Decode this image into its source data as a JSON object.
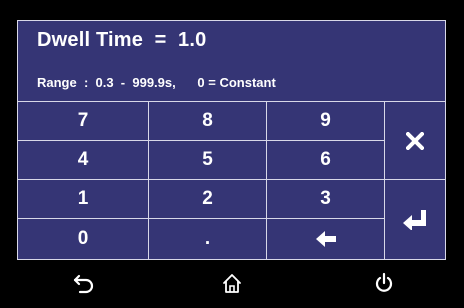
{
  "header": {
    "title": "Dwell Time  =  1.0",
    "range": "Range  :  0.3  -  999.9s,      0 = Constant"
  },
  "keypad": {
    "keys": [
      "7",
      "8",
      "9",
      "4",
      "5",
      "6",
      "1",
      "2",
      "3",
      "0",
      "."
    ],
    "clear_icon": "close-x-icon",
    "enter_icon": "enter-arrow-icon",
    "backspace_icon": "left-arrow-icon"
  },
  "footer": {
    "back_icon": "return-arrow-icon",
    "home_icon": "home-icon",
    "power_icon": "power-icon"
  },
  "colors": {
    "panel": "#353575",
    "border": "#d8d8e8",
    "text": "#ffffff",
    "background": "#000000"
  }
}
